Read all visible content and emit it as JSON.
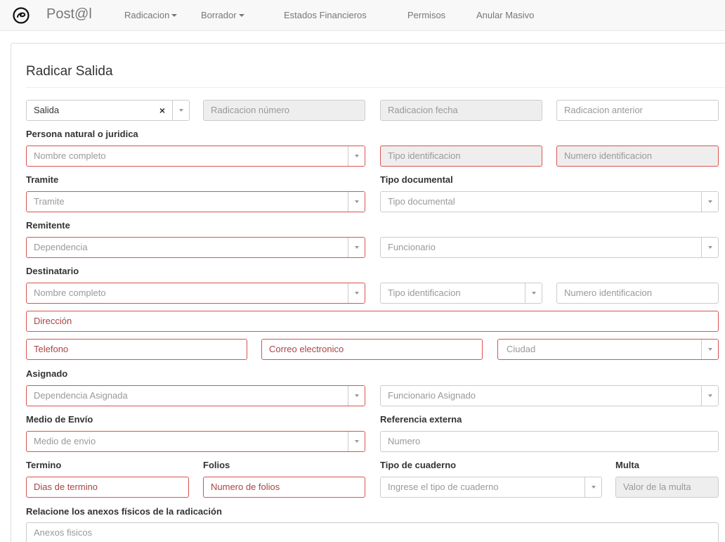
{
  "nav": {
    "brand": "Post@l",
    "logo_icon": "spiral-logo-icon",
    "items": [
      "Radicacion",
      "Borrador",
      "Estados Financieros",
      "Permisos",
      "Anular Masivo"
    ]
  },
  "page": {
    "title": "Radicar Salida"
  },
  "top_row": {
    "tipo_value": "Salida",
    "radicacion_numero_placeholder": "Radicacion número",
    "radicacion_fecha_placeholder": "Radicacion fecha",
    "radicacion_anterior_placeholder": "Radicacion anterior"
  },
  "persona": {
    "label": "Persona natural o juridica",
    "nombre_placeholder": "Nombre completo",
    "tipo_id_placeholder": "Tipo identificacion",
    "numero_id_placeholder": "Numero identificacion"
  },
  "tramite": {
    "label": "Tramite",
    "placeholder": "Tramite"
  },
  "tipo_documental": {
    "label": "Tipo documental",
    "placeholder": "Tipo documental"
  },
  "remitente": {
    "label": "Remitente",
    "dependencia_placeholder": "Dependencia",
    "funcionario_placeholder": "Funcionario"
  },
  "destinatario": {
    "label": "Destinatario",
    "nombre_placeholder": "Nombre completo",
    "tipo_id_placeholder": "Tipo identificacion",
    "numero_id_placeholder": "Numero identificacion",
    "direccion_placeholder": "Dirección",
    "telefono_placeholder": "Telefono",
    "correo_placeholder": "Correo electronico",
    "ciudad_placeholder": "Ciudad"
  },
  "asignado": {
    "label": "Asignado",
    "dependencia_placeholder": "Dependencia Asignada",
    "funcionario_placeholder": "Funcionario Asignado"
  },
  "medio_envio": {
    "label": "Medio de Envío",
    "placeholder": "Medio de envio"
  },
  "referencia_externa": {
    "label": "Referencia externa",
    "placeholder": "Numero"
  },
  "termino": {
    "label": "Termino",
    "placeholder": "Dias de termino"
  },
  "folios": {
    "label": "Folios",
    "placeholder": "Numero de folios"
  },
  "tipo_cuaderno": {
    "label": "Tipo de cuaderno",
    "placeholder": "Ingrese el tipo de cuaderno"
  },
  "multa": {
    "label": "Multa",
    "placeholder": "Valor de la multa"
  },
  "anexos": {
    "label": "Relacione los anexos físicos de la radicación",
    "placeholder": "Anexos fisicos"
  },
  "colors": {
    "required_border": "#d9534f",
    "required_text": "#a94442",
    "disabled_bg": "#eeeeee",
    "navbar_bg": "#f8f8f8"
  }
}
